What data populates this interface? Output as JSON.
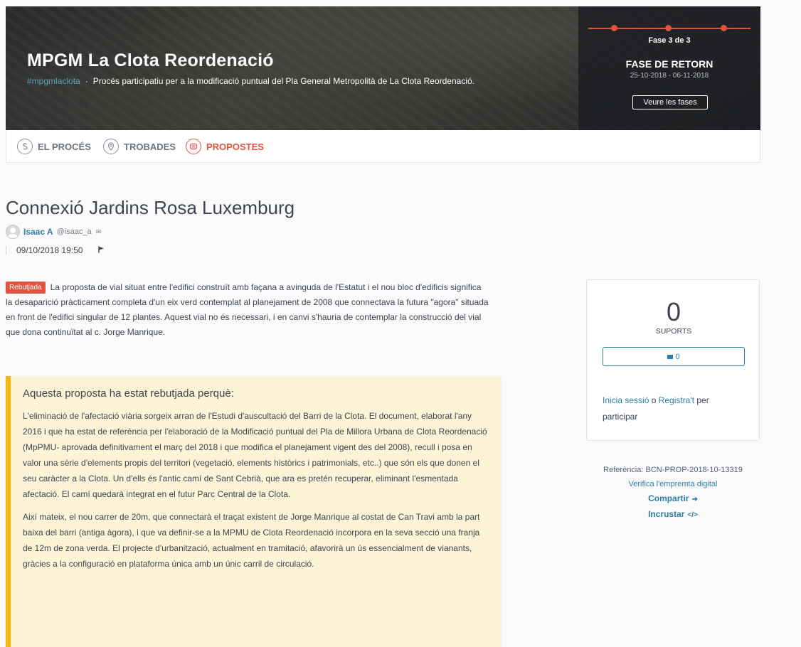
{
  "hero": {
    "title": "MPGM La Clota Reordenació",
    "hashtag": "#mpgmlaclota",
    "separator": "·",
    "description": "Procés participatiu per a la modificació puntual del Pla General Metropolità de La Clota Reordenació."
  },
  "phase": {
    "step": "Fase 3 de 3",
    "name": "FASE DE RETORN",
    "dates": "25-10-2018 - 06-11-2018",
    "button": "Veure les fases",
    "current_step": 3,
    "total_steps": 3
  },
  "tabs": [
    {
      "label": "EL PROCÉS",
      "icon": "process-icon",
      "active": false
    },
    {
      "label": "TROBADES",
      "icon": "location-pin-icon",
      "active": false
    },
    {
      "label": "PROPOSTES",
      "icon": "proposals-icon",
      "active": true
    }
  ],
  "proposal": {
    "title": "Connexió Jardins Rosa Luxemburg",
    "author_name": "Isaac A",
    "author_handle": "@isaac_a",
    "date": "09/10/2018 19:50",
    "status_badge": "Rebutjada",
    "body": "La proposta de vial situat entre l'edifici construït amb façana a avinguda de l'Estatut i el nou bloc d'edificis significa la desaparició pràcticament completa d'un eix verd contemplat al planejament de 2008 que connectava la futura \"agora\" situada en front de l'edifici singular de 12 plantes. Aquest vial no és necessari, i en canvi s'hauria de contemplar la construcció del vial que dona continuïtat al c. Jorge Manrique."
  },
  "rejection": {
    "heading": "Aquesta proposta ha estat rebutjada perquè:",
    "paragraphs": [
      "L'eliminació de l'afectació viària sorgeix arran de l'Estudi d'auscultació del Barri de la Clota. El document, elaborat l'any 2016 i que ha estat de referència per l'elaboració de la Modificació puntual del Pla de Millora Urbana de Clota Reordenació (MpPMU- aprovada definitivament el març del 2018 i que modifica el planejament vigent des del 2008), recull i posa en valor una sèrie d'elements propis del territori (vegetació, elements històrics i patrimonials, etc..) que són els que donen el seu caràcter a la Clota. Un d'ells és l'antic camí de Sant Cebrià, que ara es pretén recuperar, eliminant l'esmentada afectació. El camí quedarà integrat en el futur Parc Central de la Clota.",
      "Així mateix, el nou carrer de 20m, que connectarà el traçat existent de Jorge Manrique al costat de Can Travi amb la part baixa del barri (antiga àgora), i que va definir-se a la MPMU de Clota Reordenació  incorpora en la seva secció una franja de 12m de zona verda. El projecte d'urbanització, actualment en tramitació, afavorirà un ús essencialment de vianants, gràcies a la configuració en plataforma única amb un únic carril de circulació."
    ]
  },
  "support": {
    "count": "0",
    "label": "SUPORTS",
    "comments": "0",
    "login_link": "Inicia sessió",
    "or": " o ",
    "register_link": "Registra't",
    "participate": " per participar"
  },
  "refs": {
    "reference": "Referència: BCN-PROP-2018-10-13319",
    "verify": "Verifica l'empremta digital",
    "share": "Compartir",
    "embed": "Incrustar"
  },
  "colors": {
    "accent": "#e0533f",
    "link": "#2e7fa1",
    "warning_border": "#f5b80f",
    "warning_bg": "#fdf3d6"
  }
}
